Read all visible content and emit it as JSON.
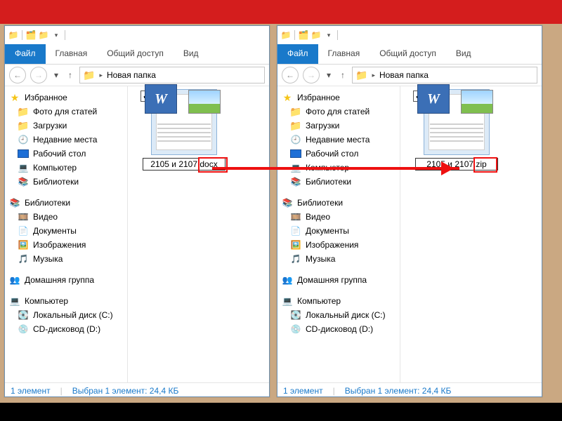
{
  "ribbon": {
    "file": "Файл",
    "home": "Главная",
    "share": "Общий доступ",
    "view": "Вид"
  },
  "nav": {
    "location": "Новая папка"
  },
  "tree": {
    "favorites": "Избранное",
    "fav_items": [
      "Фото для статей",
      "Загрузки",
      "Недавние места",
      "Рабочий стол",
      "Компьютер",
      "Библиотеки"
    ],
    "libraries": "Библиотеки",
    "lib_items": [
      "Видео",
      "Документы",
      "Изображения",
      "Музыка"
    ],
    "homegroup": "Домашняя группа",
    "computer": "Компьютер",
    "comp_items": [
      "Локальный диск (C:)",
      "CD-дисковод (D:)"
    ]
  },
  "file_left": {
    "name": "2105 и 2107",
    "ext": ".docx",
    "full": "2105 и 2107.docx"
  },
  "file_right": {
    "name": "2105 и 2107",
    "ext": ".zip",
    "full": "2105 и 2107.zip"
  },
  "status": {
    "count": "1 элемент",
    "sel": "Выбран 1 элемент: 24,4 КБ"
  }
}
